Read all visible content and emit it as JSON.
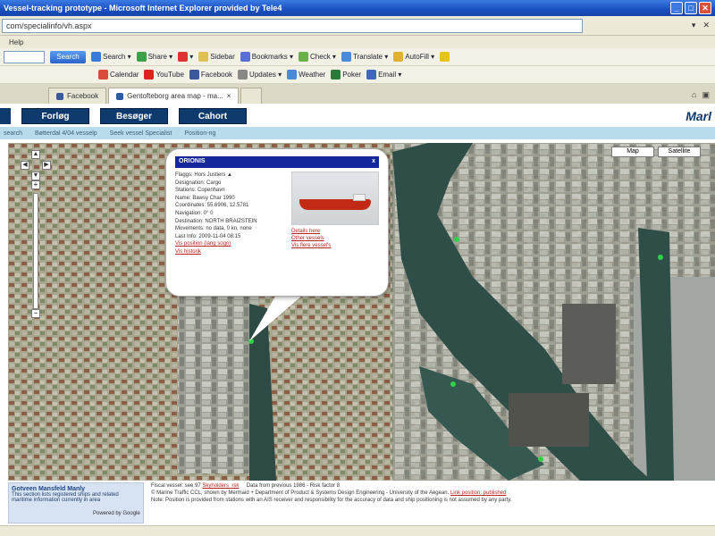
{
  "window": {
    "title": "Vessel-tracking prototype - Microsoft Internet Explorer provided by Tele4",
    "controls": [
      "_",
      "□",
      "✕"
    ]
  },
  "address": {
    "value": "com/specialinfo/vh.aspx",
    "right_items": [
      "▾",
      "✕"
    ]
  },
  "menu": {
    "label": "Help"
  },
  "toolbar1": {
    "search_button": "Search",
    "items": [
      "Search ▾",
      "Share ▾",
      "▾",
      "Sidebar",
      "Bookmarks ▾",
      "Check ▾",
      "Translate ▾",
      "AutoFill ▾"
    ]
  },
  "toolbar2": {
    "items": [
      "Calendar",
      "YouTube",
      "Facebook",
      "Updates ▾",
      "Weather",
      "Poker",
      "Email ▾"
    ]
  },
  "tabs": [
    {
      "label": "Facebook"
    },
    {
      "label": "Gentofteborg area map - ma..."
    }
  ],
  "nav": {
    "buttons": [
      "Forløg",
      "Besøger",
      "Cahort"
    ],
    "brand": "Marl"
  },
  "breadcrumbs": [
    "search",
    "Bøtterdal 4/04 vesselp",
    "Seek vessel Specialist",
    "Position-ng"
  ],
  "map": {
    "type_buttons": [
      "Map",
      "Satellite"
    ],
    "pan_arrows": [
      "▲",
      "◀",
      "▶",
      "▼"
    ],
    "zoom_in": "+",
    "zoom_out": "−"
  },
  "popup": {
    "title": "ORIONIS",
    "close": "x",
    "details": [
      "Flaggs: Hors Justiers ▲",
      "Designation: Cargo",
      "Stations: Copenhavn",
      "Name: Bawsy Char 1990",
      "Coordinates: 55.6906, 12.5781",
      "Navigation: 0° 0",
      "Destination: NORTH BRAIZSTEIN",
      "Movements: no data, 0 kn, none",
      "Last Info: 2009-11-04 08:15"
    ],
    "links": [
      "Vis position (lang sogn)",
      "Vis historik"
    ],
    "side_links": [
      "Details here",
      "Other vessels",
      "Vis flere vessel's"
    ]
  },
  "footer": {
    "box_title": "Gotveen Mansfeld Manly",
    "box_text": "This section lists registered ships and related maritime information currently in area",
    "google": "Powered by Google",
    "line1_prefix": "Fiscal vessel: see 97",
    "line1_link": "Skyholders_rsk",
    "line1_rest": "Data from previous 1986 - Risk factor 8",
    "line2": "© Marine Traffic CCL, shown by Mermaid + Department of Product & Systems Design Engineering - University of the Aegean.",
    "line2_link": "Link position: published",
    "line3": "Note: Position is provided from stations with an AIS receiver and responsibility for the accuracy of data and ship positioning is not assumed by any party."
  }
}
